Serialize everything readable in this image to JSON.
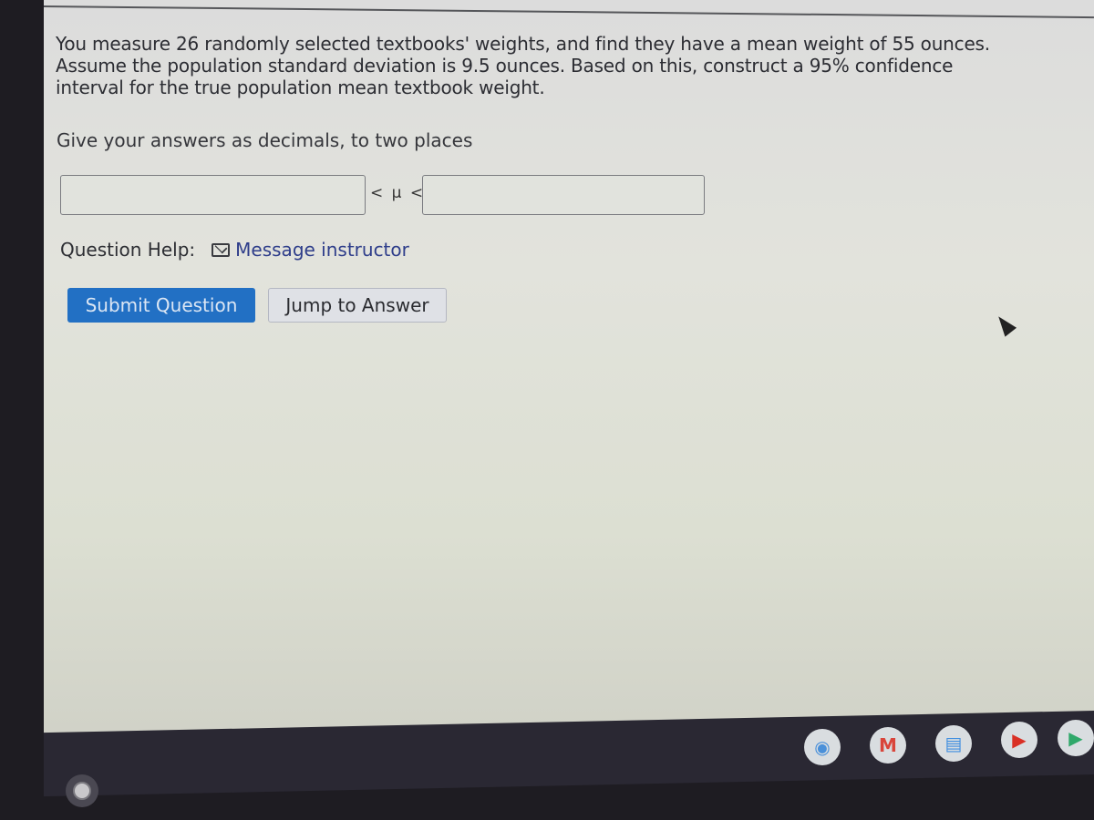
{
  "question": {
    "text": "You measure 26 randomly selected textbooks' weights, and find they have a mean weight of 55 ounces. Assume the population standard deviation is 9.5 ounces. Based on this, construct a 95% confidence interval for the true population mean textbook weight.",
    "instruction": "Give your answers as decimals, to two places"
  },
  "answer": {
    "lower_value": "",
    "upper_value": "",
    "mu_label": "< μ <"
  },
  "help": {
    "label": "Question Help:",
    "message_link": "Message instructor"
  },
  "buttons": {
    "submit": "Submit Question",
    "jump": "Jump to Answer"
  },
  "shelf": {
    "apps": [
      {
        "name": "chrome",
        "glyph": "◉",
        "color": "#4a90d9"
      },
      {
        "name": "gmail",
        "glyph": "M",
        "color": "#d9453b"
      },
      {
        "name": "docs",
        "glyph": "▤",
        "color": "#3f8ee0"
      },
      {
        "name": "youtube",
        "glyph": "▶",
        "color": "#d93025"
      },
      {
        "name": "play-store",
        "glyph": "▶",
        "color": "#2fa86a"
      }
    ]
  }
}
